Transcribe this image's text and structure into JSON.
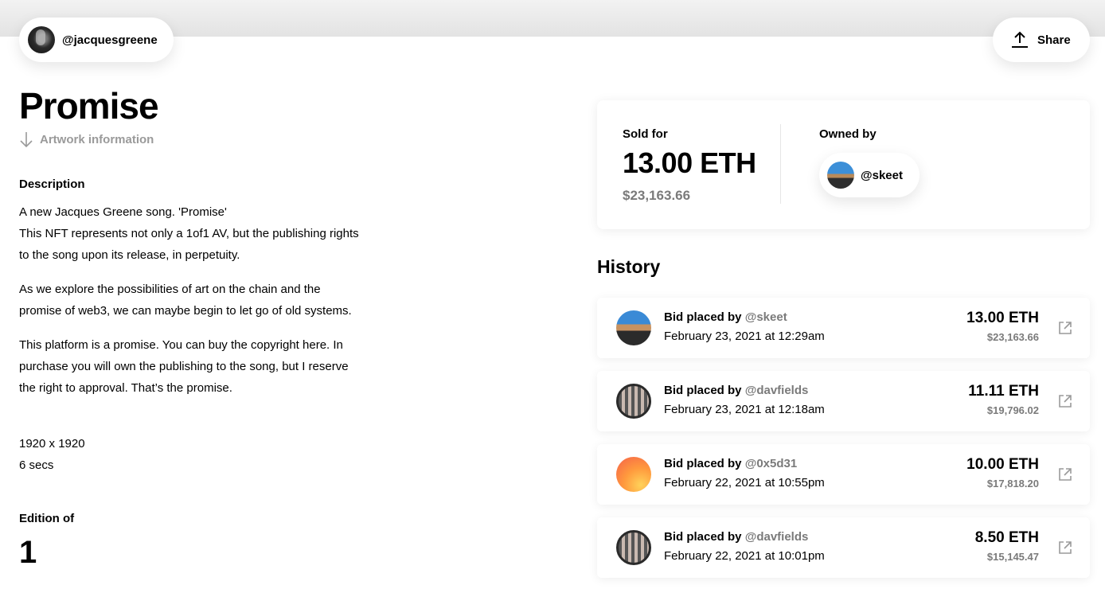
{
  "header": {
    "creator_handle": "@jacquesgreene",
    "share_label": "Share"
  },
  "artwork": {
    "title": "Promise",
    "info_link": "Artwork information",
    "description_heading": "Description",
    "description": [
      "A new Jacques Greene song. 'Promise'\nThis NFT represents not only a 1of1 AV, but the publishing rights to the song upon its release, in perpetuity.",
      "As we explore the possibilities of art on the chain and the promise of web3, we can maybe begin to let go of old systems.",
      "This platform is a promise. You can buy the copyright here. In purchase you will own the publishing to the song, but I reserve the right to approval. That’s the promise."
    ],
    "dimensions": "1920 x 1920",
    "duration": "6 secs",
    "edition_label": "Edition of",
    "edition_value": "1"
  },
  "sale": {
    "sold_label": "Sold for",
    "sold_eth": "13.00 ETH",
    "sold_usd": "$23,163.66",
    "owned_label": "Owned by",
    "owner_handle": "@skeet"
  },
  "history": {
    "title": "History",
    "items": [
      {
        "action": "Bid placed by",
        "user": "@skeet",
        "date": "February 23, 2021 at 12:29am",
        "eth": "13.00 ETH",
        "usd": "$23,163.66",
        "avatar": "skeet"
      },
      {
        "action": "Bid placed by",
        "user": "@davfields",
        "date": "February 23, 2021 at 12:18am",
        "eth": "11.11 ETH",
        "usd": "$19,796.02",
        "avatar": "davfields"
      },
      {
        "action": "Bid placed by",
        "user": "@0x5d31",
        "date": "February 22, 2021 at 10:55pm",
        "eth": "10.00 ETH",
        "usd": "$17,818.20",
        "avatar": "0x5d31"
      },
      {
        "action": "Bid placed by",
        "user": "@davfields",
        "date": "February 22, 2021 at 10:01pm",
        "eth": "8.50 ETH",
        "usd": "$15,145.47",
        "avatar": "davfields"
      }
    ]
  },
  "icons": {
    "share": "share-upload-icon",
    "arrow_down": "arrow-down-icon",
    "external_link": "external-link-icon"
  }
}
